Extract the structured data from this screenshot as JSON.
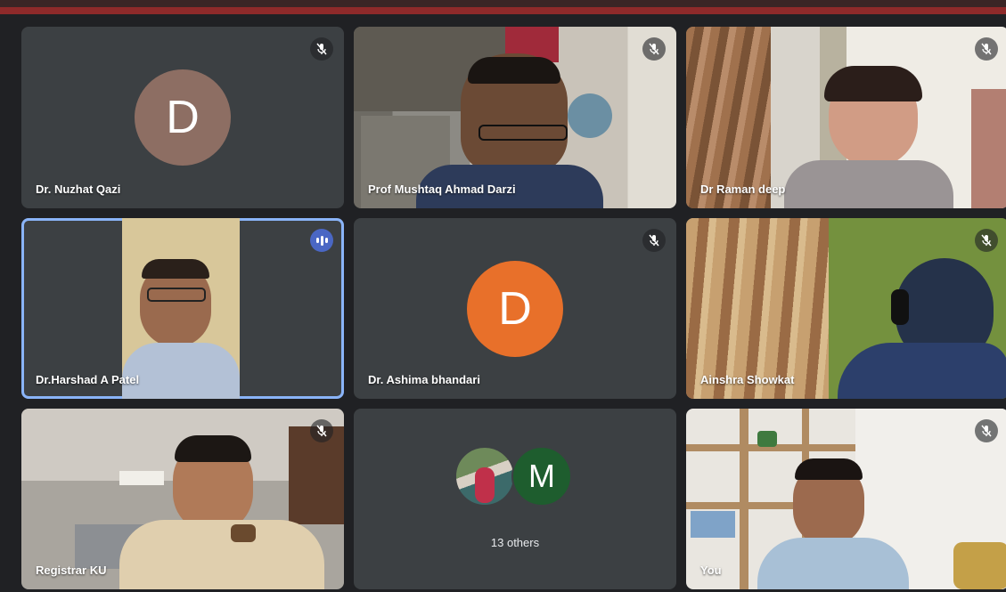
{
  "tiles": [
    {
      "name": "Dr. Nuzhat Qazi",
      "avatar_letter": "D",
      "avatar_color": "#8d6e63",
      "mic": "muted"
    },
    {
      "name": "Prof Mushtaq Ahmad Darzi",
      "mic": "muted"
    },
    {
      "name": "Dr Raman deep",
      "mic": "muted"
    },
    {
      "name": "Dr.Harshad A Patel",
      "mic": "speaking"
    },
    {
      "name": "Dr. Ashima bhandari",
      "avatar_letter": "D",
      "avatar_color": "#e8702a",
      "mic": "muted"
    },
    {
      "name": "Ainshra Showkat",
      "mic": "muted"
    },
    {
      "name": "Registrar KU",
      "mic": "muted"
    },
    {
      "others_label": "13 others",
      "avatar_letter": "M",
      "avatar_color": "#1e5d2e"
    },
    {
      "name": "You",
      "mic": "muted"
    }
  ],
  "colors": {
    "speaking_border": "#8ab4f8",
    "tile_bg": "#3c4043"
  }
}
